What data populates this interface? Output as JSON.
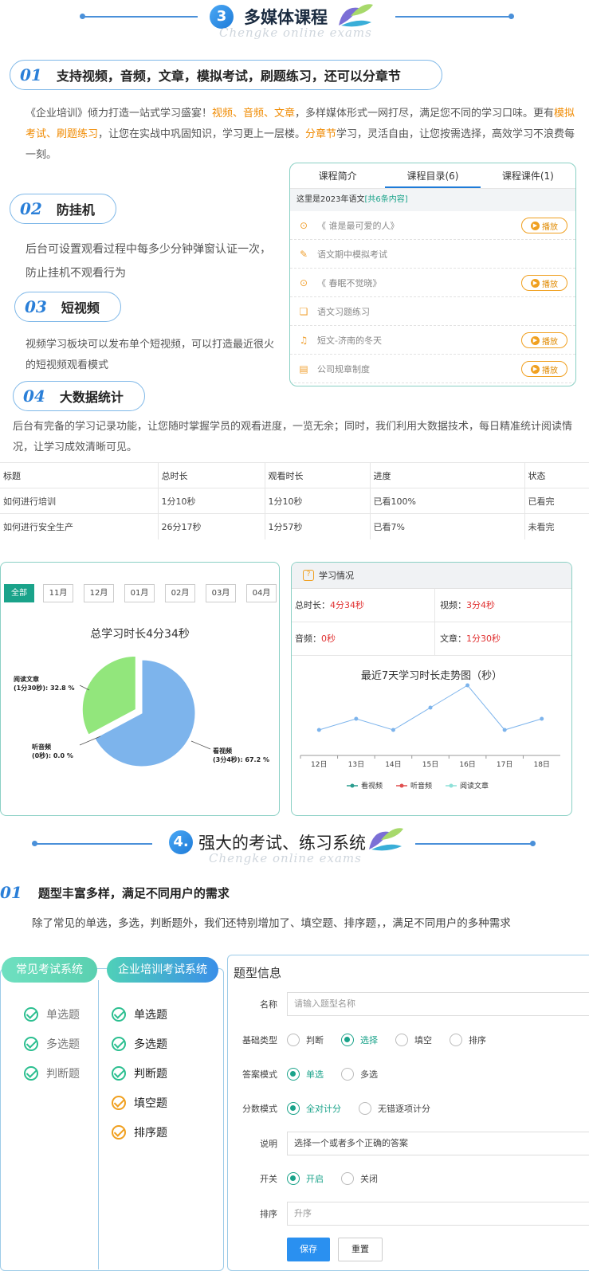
{
  "section3": {
    "num": "3",
    "title": "多媒体课程",
    "watermark": "Chengke online exams",
    "features": [
      {
        "num": "01",
        "label": "支持视频，音频，文章，模拟考试，刷题练习，还可以分章节"
      },
      {
        "num": "02",
        "label": "防挂机"
      },
      {
        "num": "03",
        "label": "短视频"
      },
      {
        "num": "04",
        "label": "大数据统计"
      }
    ],
    "intro": {
      "p1": "《企业培训》倾力打造一站式学习盛宴！",
      "h1": "视频、音频、文章",
      "p2": "，多样媒体形式一网打尽，满足您不同的学习口味。更有",
      "h2": "模拟考试、刷题练习",
      "p3": "，让您在实战中巩固知识，学习更上一层楼。",
      "h3": "分章节",
      "p4": "学习，灵活自由，让您按需选择，高效学习不浪费每一刻。"
    },
    "antihang_text": "后台可设置观看过程中每多少分钟弹窗认证一次，防止挂机不观看行为",
    "shortvideo_text": "视频学习板块可以发布单个短视频，可以打造最近很火的短视频观看模式",
    "bigdata_text": "后台有完备的学习记录功能，让您随时掌握学员的观看进度，一览无余；同时，我们利用大数据技术，每日精准统计阅读情况，让学习成效清晰可见。"
  },
  "course_panel": {
    "tabs": [
      "课程简介",
      "课程目录(6)",
      "课程课件(1)"
    ],
    "info_prefix": "这里是2023年语文",
    "info_count": "[共6条内容]",
    "items": [
      {
        "icon": "play-circle-icon",
        "title": "《 谁是最可爱的人》",
        "play": "播放"
      },
      {
        "icon": "exam-icon",
        "title": "语文期中模拟考试",
        "play": ""
      },
      {
        "icon": "play-circle-icon",
        "title": "《 春眠不觉晓》",
        "play": "播放"
      },
      {
        "icon": "book-icon",
        "title": "语文习题练习",
        "play": ""
      },
      {
        "icon": "headphone-icon",
        "title": "短文-济南的冬天",
        "play": "播放"
      },
      {
        "icon": "document-icon",
        "title": "公司规章制度",
        "play": "播放"
      }
    ]
  },
  "progress_table": {
    "headers": [
      "标题",
      "总时长",
      "观看时长",
      "进度",
      "状态"
    ],
    "rows": [
      [
        "如何进行培训",
        "1分10秒",
        "1分10秒",
        "已看100%",
        "已看完"
      ],
      [
        "如何进行安全生产",
        "26分17秒",
        "1分57秒",
        "已看7%",
        "未看完"
      ]
    ]
  },
  "month_tabs": [
    "全部",
    "11月",
    "12月",
    "01月",
    "02月",
    "03月",
    "04月"
  ],
  "study_panel": {
    "title": "学习情况",
    "total_label": "总时长：",
    "total_value": "4分34秒",
    "video_label": "视频：",
    "video_value": "3分4秒",
    "audio_label": "音频：",
    "audio_value": "0秒",
    "article_label": "文章：",
    "article_value": "1分30秒"
  },
  "chart_data": [
    {
      "type": "pie",
      "title": "总学习时长4分34秒",
      "slices": [
        {
          "label": "看视频\n(3分4秒): 67.2 %",
          "value": 67.2,
          "color": "#7db4ec"
        },
        {
          "label": "阅读文章\n(1分30秒): 32.8 %",
          "value": 32.8,
          "color": "#92e67c"
        },
        {
          "label": "听音频\n(0秒): 0.0 %",
          "value": 0.0,
          "color": "#333333"
        }
      ]
    },
    {
      "type": "line",
      "title": "最近7天学习时长走势图（秒）",
      "categories": [
        "12日",
        "13日",
        "14日",
        "15日",
        "16日",
        "17日",
        "18日"
      ],
      "series": [
        {
          "name": "看视频",
          "color": "#2a9d8f",
          "values": [
            10,
            20,
            10,
            30,
            50,
            10,
            20
          ]
        },
        {
          "name": "听音频",
          "color": "#e05050",
          "values": []
        },
        {
          "name": "阅读文章",
          "color": "#8ee0d8",
          "values": []
        }
      ]
    }
  ],
  "section4": {
    "num": "4.",
    "title": "强大的考试、练习系统",
    "watermark": "Chengke online exams",
    "feature_num": "01",
    "feature_label": "题型丰富多样，满足不同用户的需求",
    "desc": "除了常见的单选，多选，判断题外，我们还特别增加了、填空题、排序题，，满足不同用户的多种需求",
    "col1_title": "常见考试系统",
    "col1_items": [
      "单选题",
      "多选题",
      "判断题"
    ],
    "col2_title": "企业培训考试系统",
    "col2_items": [
      "单选题",
      "多选题",
      "判断题",
      "填空题",
      "排序题"
    ]
  },
  "form": {
    "title": "题型信息",
    "name_label": "名称",
    "name_placeholder": "请输入题型名称",
    "type_label": "基础类型",
    "type_options": [
      "判断",
      "选择",
      "填空",
      "排序"
    ],
    "answer_label": "答案模式",
    "answer_options": [
      "单选",
      "多选"
    ],
    "score_label": "分数模式",
    "score_options": [
      "全对计分",
      "无错逐项计分"
    ],
    "desc_label": "说明",
    "desc_value": "选择一个或者多个正确的答案",
    "switch_label": "开关",
    "switch_options": [
      "开启",
      "关闭"
    ],
    "sort_label": "排序",
    "sort_placeholder": "升序",
    "save": "保存",
    "reset": "重置"
  }
}
